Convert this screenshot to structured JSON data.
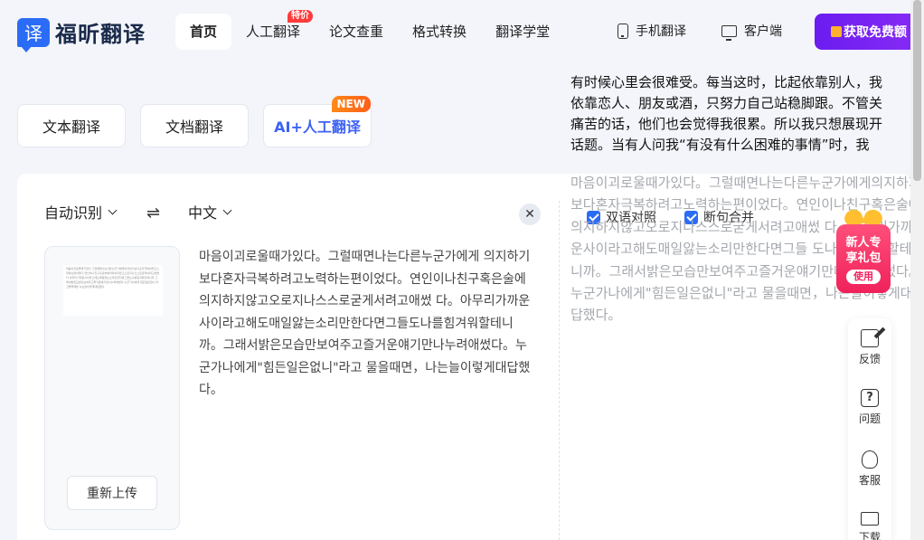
{
  "brand": {
    "logo_char": "译",
    "name": "福昕翻译"
  },
  "nav": [
    {
      "label": "首页",
      "active": true,
      "badge": ""
    },
    {
      "label": "人工翻译",
      "active": false,
      "badge": "特价"
    },
    {
      "label": "论文查重",
      "active": false,
      "badge": ""
    },
    {
      "label": "格式转换",
      "active": false,
      "badge": ""
    },
    {
      "label": "翻译学堂",
      "active": false,
      "badge": ""
    }
  ],
  "header_right": {
    "mobile": "手机翻译",
    "client": "客户端",
    "free_btn": "获取免费额"
  },
  "modes": {
    "text": "文本翻译",
    "doc": "文档翻译",
    "ai": "AI+人工翻译",
    "ai_badge": "NEW"
  },
  "translator": {
    "source_lang": "自动识别",
    "swap_icon": "⇌",
    "target_lang": "中文",
    "clear_icon": "✕",
    "reupload": "重新上传",
    "doc_thumb_text": "마음이괴로울때가있다 그럴때면나는다른누군가에게의지하기보다혼자극복하려고노력하는편이었다 연인이나친구혹은술에의지하지않고오로지나스스로굳게서려고애썼다 아무리가까운사이라고해도매일앓는소리만한다면그들도나를힘겨워할테니까 그래서밝은모습만보여주고즐거운얘기만나누려애썼다 누군가나에게 힘든일은없니 라고물을때면 나는늘이렇게대답했다",
    "source_text": "마음이괴로울때가있다。그럴때면나는다른누군가에게 의지하기보다혼자극복하려고노력하는편이었다。연인이나친구혹은술에의지하지않고오로지나스스로굳게서려고애썼 다。아무리가까운사이라고해도매일앓는소리만한다면그들도나를힘겨워할테니까。그래서밝은모습만보여주고즐거운얘기만나누려애썼다。누군가나에게\"힘든일은없니\"라고 물을때면，나는늘이렇게대답했다。",
    "option_bilingual": "双语对照",
    "option_merge": "断句合并",
    "target_lines": [
      "有时候心里会很难受。每当这时，比起依靠别人，我",
      "依靠恋人、朋友或酒，只努力自己站稳脚跟。不管关",
      "痛苦的话，他们也会觉得我很累。所以我只想展现开",
      "话题。当有人问我“有没有什么困难的事情”时，我"
    ],
    "target_source_text": "마음이괴로울때가있다。그럴때면나는다른누군가에게의지하기보다혼자극복하려고노력하는편이었다。연인이나친구혹은술에의지하지않고오로지나스스로굳게서려고애썼 다。아무리가까운사이라고해도매일앓는소리만한다면그들 도나를힘겨워할테니까。그래서밝은모습만보여주고즐거운얘기만나누려애썼다。누군가나에게\"힘든일은없니\"라고 물을때면，나는늘이렇게대답했다。"
  },
  "promo": {
    "line1": "新人专",
    "line2": "享礼包",
    "use": "使用"
  },
  "sidebar": {
    "feedback": "反馈",
    "question": "问题",
    "service": "客服",
    "download": "下载"
  },
  "icons": [
    "mobile-icon",
    "desktop-icon",
    "gift-icon",
    "swap-icon",
    "close-icon",
    "edit-icon",
    "question-icon",
    "headset-icon",
    "monitor-icon"
  ]
}
